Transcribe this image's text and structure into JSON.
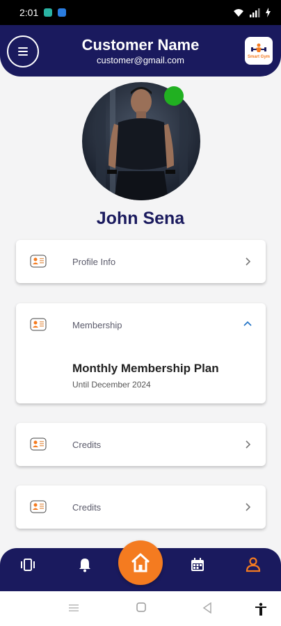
{
  "status_bar": {
    "time": "2:01"
  },
  "header": {
    "customer_name": "Customer Name",
    "customer_email": "customer@gmail.com",
    "logo_text": "Smart Gym"
  },
  "profile": {
    "name": "John Sena",
    "online": true
  },
  "cards": {
    "profile_info": {
      "label": "Profile Info"
    },
    "membership": {
      "label": "Membership",
      "plan_title": "Monthly Membership Plan",
      "plan_until": "Until December 2024"
    },
    "credits_1": {
      "label": "Credits"
    },
    "credits_2": {
      "label": "Credits"
    }
  },
  "bottom_nav": {
    "items": [
      "dashboard-icon",
      "bell-icon",
      "home-icon",
      "calendar-icon",
      "user-icon"
    ],
    "active": "user-icon"
  },
  "colors": {
    "primary": "#1a1a5e",
    "accent": "#f47b20",
    "online": "#21b021",
    "background": "#f4f4f5"
  }
}
